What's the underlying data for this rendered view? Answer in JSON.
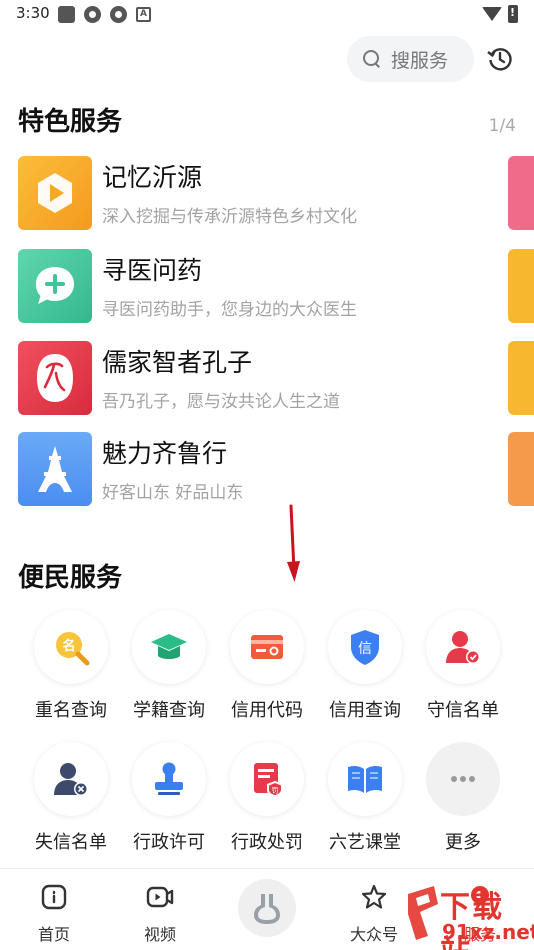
{
  "status_bar": {
    "time": "3:30"
  },
  "header": {
    "search_label": "搜服务"
  },
  "featured": {
    "title": "特色服务",
    "page_indicator": "1/4",
    "items": [
      {
        "title": "记忆沂源",
        "desc": "深入挖掘与传承沂源特色乡村文化",
        "icon": "play-icon",
        "color": "#f7a826"
      },
      {
        "title": "寻医问药",
        "desc": "寻医问药助手，您身边的大众医生",
        "icon": "medical-chat-icon",
        "color": "#3ec49a"
      },
      {
        "title": "儒家智者孔子",
        "desc": "吾乃孔子，愿与汝共论人生之道",
        "icon": "seal-icon",
        "color": "#e6394a"
      },
      {
        "title": "魅力齐鲁行",
        "desc": "好客山东 好品山东",
        "icon": "tower-icon",
        "color": "#3f8ef2"
      }
    ]
  },
  "convenience": {
    "title": "便民服务",
    "items": [
      {
        "label": "重名查询",
        "icon": "name-search-icon"
      },
      {
        "label": "学籍查询",
        "icon": "graduation-cap-icon"
      },
      {
        "label": "信用代码",
        "icon": "credit-card-icon"
      },
      {
        "label": "信用查询",
        "icon": "credit-shield-icon"
      },
      {
        "label": "守信名单",
        "icon": "trusted-user-icon"
      },
      {
        "label": "失信名单",
        "icon": "untrusted-user-icon"
      },
      {
        "label": "行政许可",
        "icon": "stamp-icon"
      },
      {
        "label": "行政处罚",
        "icon": "penalty-doc-icon"
      },
      {
        "label": "六艺课堂",
        "icon": "book-icon"
      },
      {
        "label": "更多",
        "icon": "more-icon"
      }
    ],
    "icons": {
      "grid_11": "名",
      "grid_14": "信",
      "grid_18": "罚"
    }
  },
  "bottom_nav": {
    "items": [
      {
        "label": "首页",
        "icon": "home-icon"
      },
      {
        "label": "视频",
        "icon": "video-icon"
      },
      {
        "label": "",
        "icon": "center-logo-icon"
      },
      {
        "label": "大众号",
        "icon": "star-icon"
      },
      {
        "label": "服务",
        "icon": "service-icon"
      }
    ]
  },
  "watermark": {
    "line1": "下载站",
    "line2": "91xz.net"
  },
  "colors": {
    "accent_red": "#e2352e",
    "peek_colors": [
      "#f06a8a",
      "#f7b830",
      "#f7b830",
      "#f59a4a"
    ]
  }
}
